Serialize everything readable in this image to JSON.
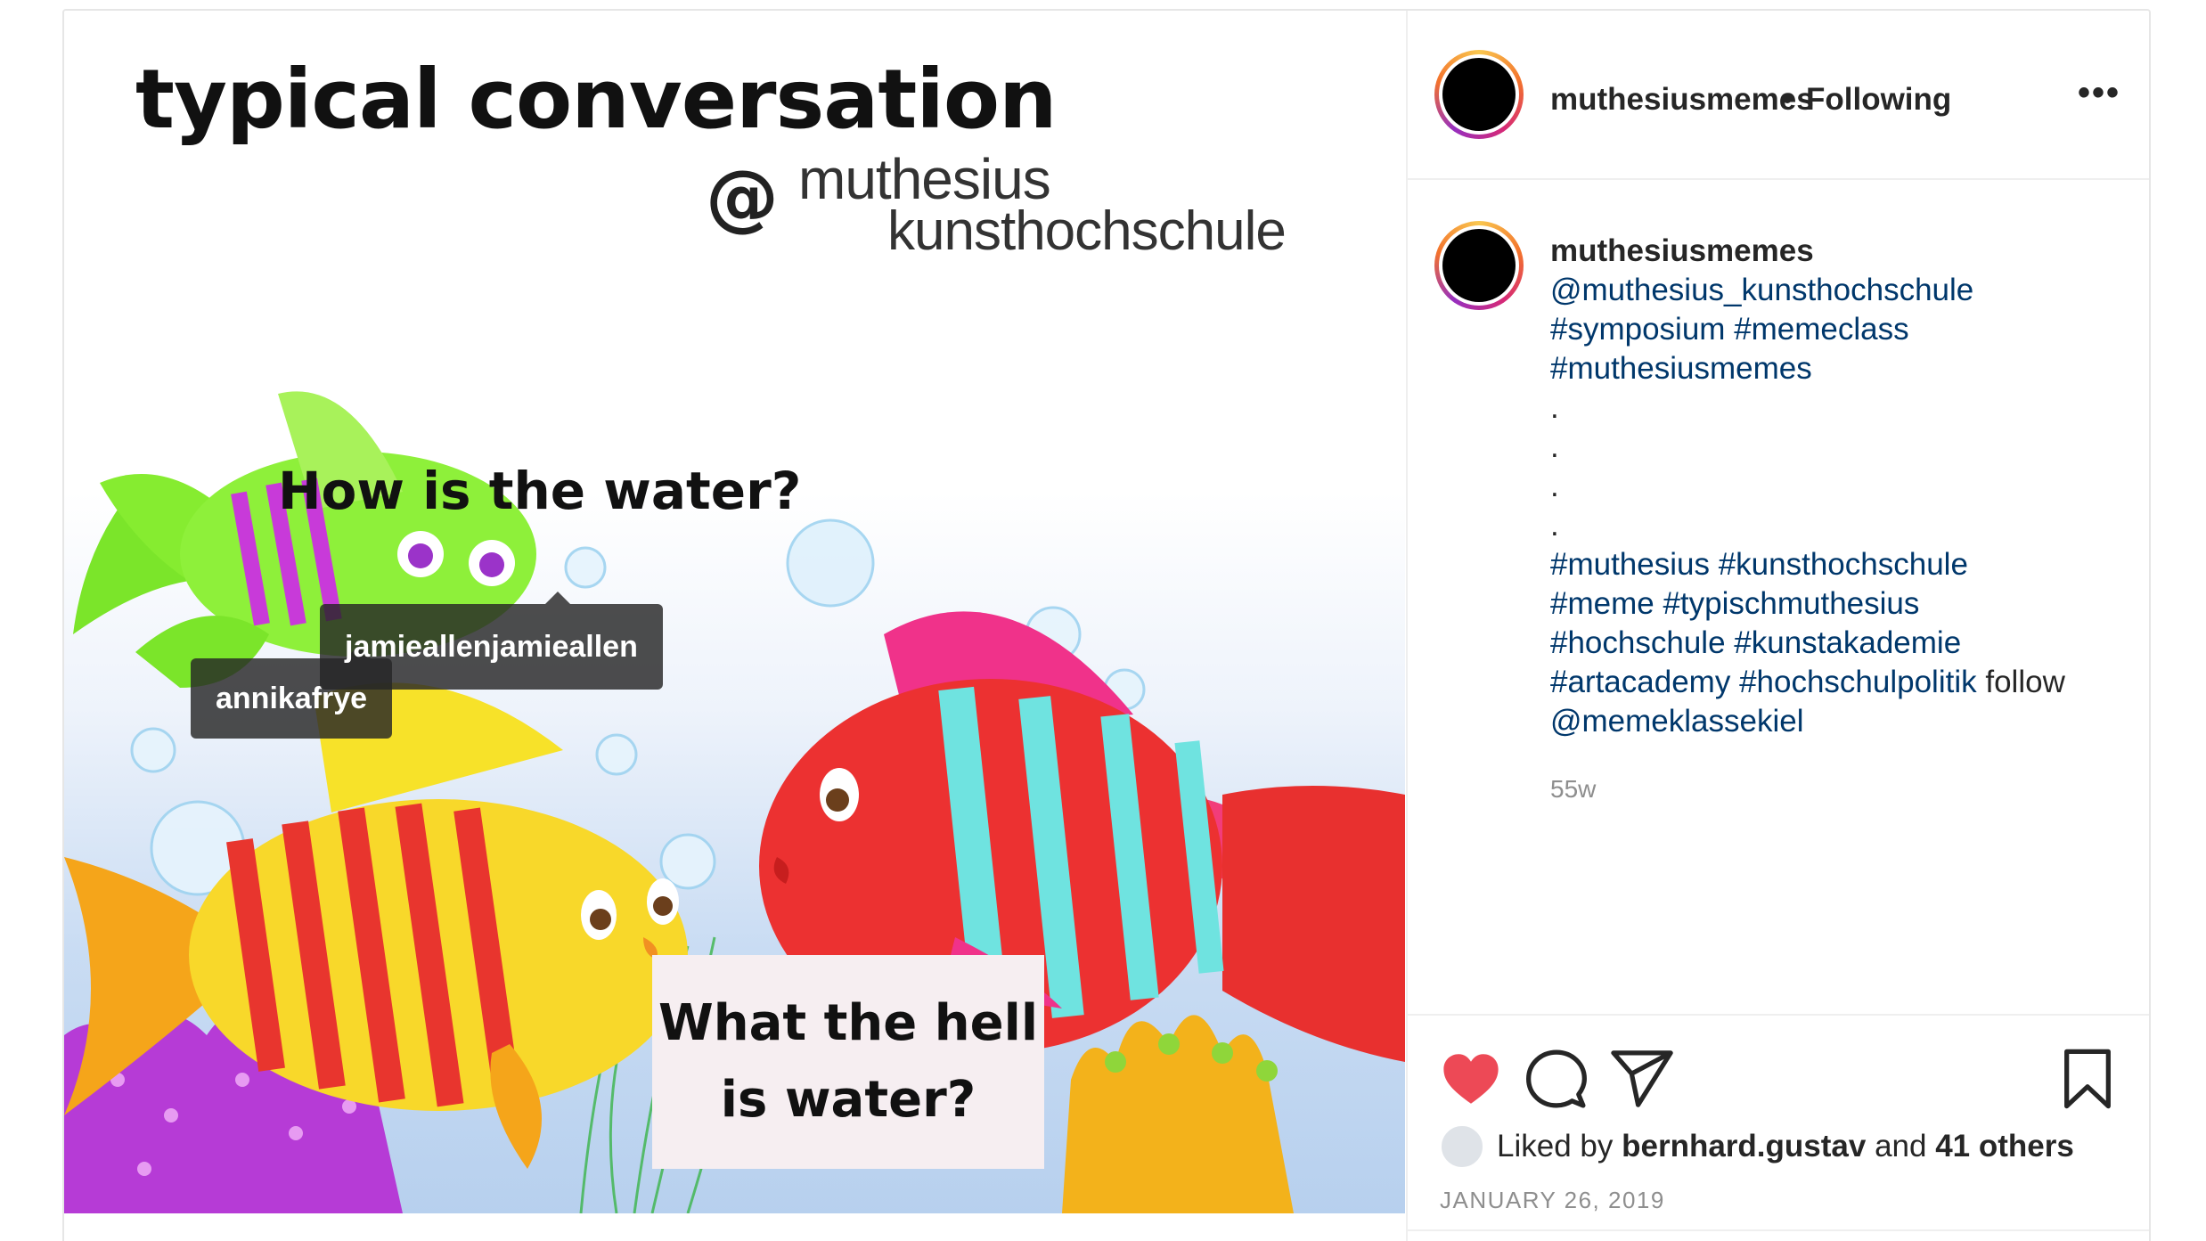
{
  "meme": {
    "title": "typical conversation",
    "at": "@",
    "brand_line1": "muthesius",
    "brand_line2": "kunsthochschule",
    "question": "How is the water?",
    "answer_line1": "What the hell",
    "answer_line2": "is water?"
  },
  "tags": [
    "jamieallenjamieallen",
    "annikafrye"
  ],
  "header": {
    "username": "muthesiusmemes",
    "separator": "•",
    "follow_status": "Following",
    "more_icon": "more-horizontal-icon"
  },
  "caption": {
    "username": "muthesiusmemes",
    "mention": "@muthesius_kunsthochschule",
    "hashtags_1": [
      "#symposium",
      "#memeclass"
    ],
    "hashtag_2": "#muthesiusmemes",
    "dots": [
      ".",
      ".",
      ".",
      "."
    ],
    "hashtags_3": [
      "#muthesius",
      "#kunsthochschule"
    ],
    "hashtags_4": [
      "#meme",
      "#typischmuthesius"
    ],
    "hashtags_5": [
      "#hochschule",
      "#kunstakademie"
    ],
    "hashtags_6": [
      "#artacademy",
      "#hochschulpolitik"
    ],
    "follow_word": "follow",
    "mention_2": "@memeklassekiel"
  },
  "time_ago": "55w",
  "actions": {
    "like_icon": "heart-icon",
    "comment_icon": "comment-icon",
    "share_icon": "paper-plane-icon",
    "save_icon": "bookmark-icon",
    "like_color": "#ed4956"
  },
  "likes": {
    "prefix": "Liked by",
    "user": "bernhard.gustav",
    "and": "and",
    "others": "41 others"
  },
  "date": "JANUARY 26, 2019"
}
